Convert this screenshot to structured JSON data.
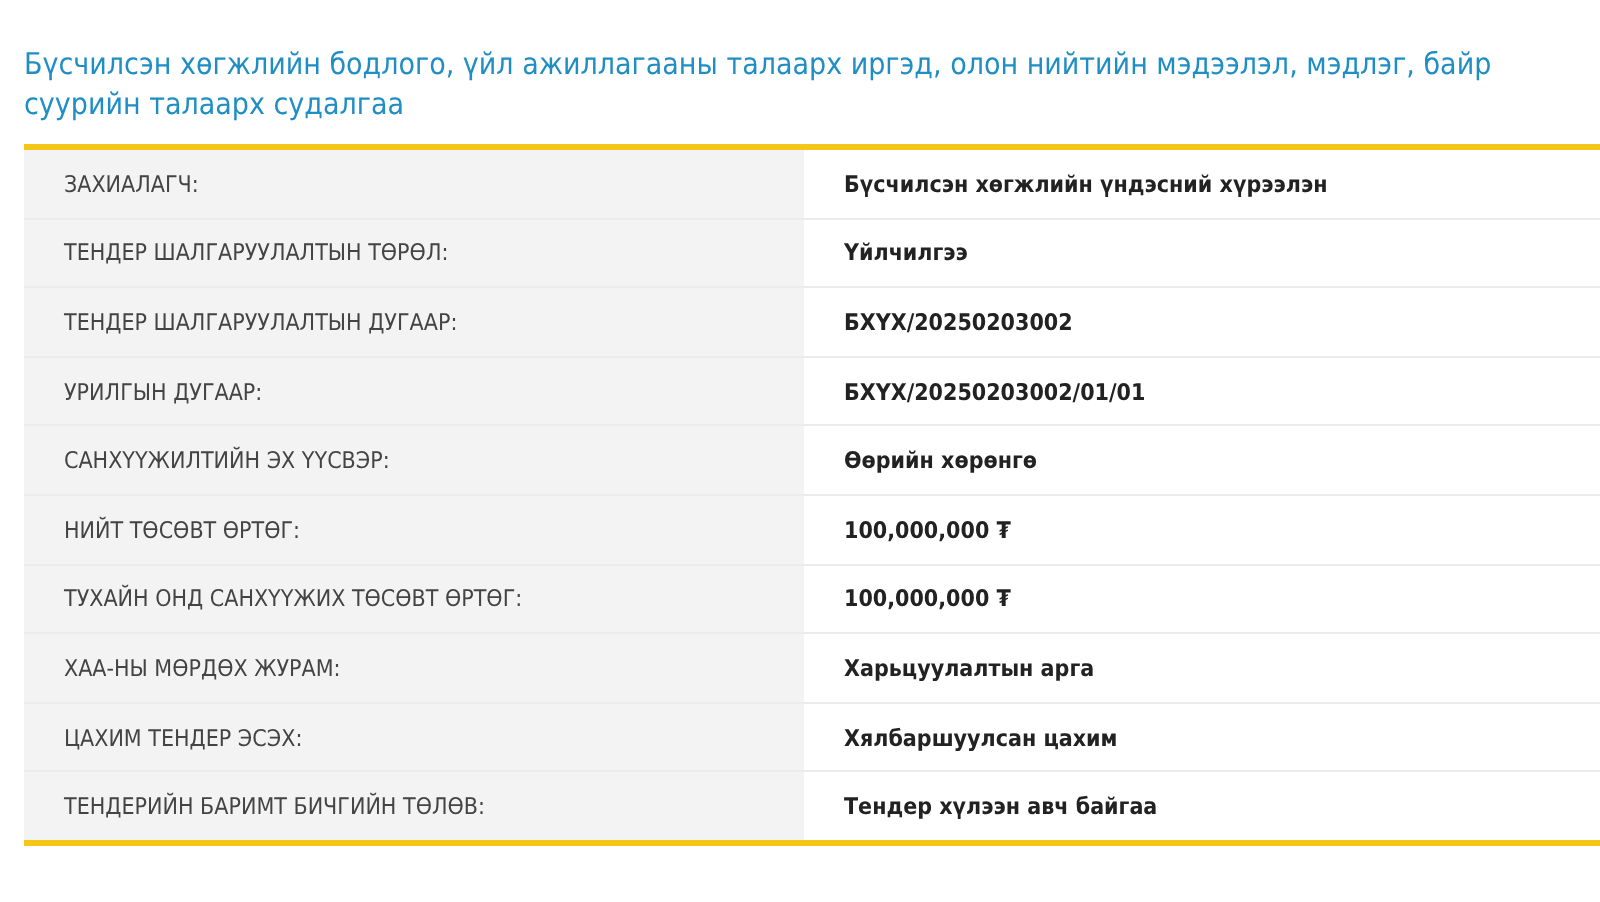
{
  "title": "Бүсчилсэн хөгжлийн бодлого, үйл ажиллагааны талаарх иргэд, олон нийтийн мэдээлэл, мэдлэг, байр суурийн талаарх судалгаа",
  "rows": [
    {
      "label": "ЗАХИАЛАГЧ:",
      "value": "Бүсчилсэн хөгжлийн үндэсний хүрээлэн"
    },
    {
      "label": "ТЕНДЕР ШАЛГАРУУЛАЛТЫН ТӨРӨЛ:",
      "value": "Үйлчилгээ"
    },
    {
      "label": "ТЕНДЕР ШАЛГАРУУЛАЛТЫН ДУГААР:",
      "value": "БХҮХ/20250203002"
    },
    {
      "label": "УРИЛГЫН ДУГААР:",
      "value": "БХҮХ/20250203002/01/01"
    },
    {
      "label": "САНХҮҮЖИЛТИЙН ЭХ ҮҮСВЭР:",
      "value": "Өөрийн хөрөнгө"
    },
    {
      "label": "НИЙТ ТӨСӨВТ ӨРТӨГ:",
      "value": "100,000,000 ₮"
    },
    {
      "label": "ТУХАЙН ОНД САНХҮҮЖИХ ТӨСӨВТ ӨРТӨГ:",
      "value": "100,000,000 ₮"
    },
    {
      "label": "ХАА-НЫ МӨРДӨХ ЖУРАМ:",
      "value": "Харьцуулалтын арга"
    },
    {
      "label": "ЦАХИМ ТЕНДЕР ЭСЭХ:",
      "value": "Хялбаршуулсан цахим"
    },
    {
      "label": "ТЕНДЕРИЙН БАРИМТ БИЧГИЙН ТӨЛӨВ:",
      "value": "Тендер хүлээн авч байгаа"
    }
  ]
}
